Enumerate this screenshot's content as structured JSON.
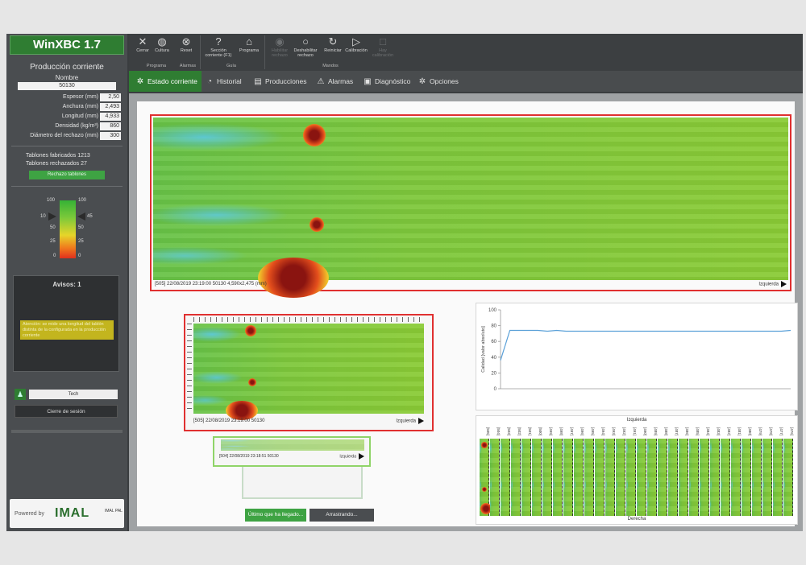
{
  "app": {
    "title": "WinXBC 1.7"
  },
  "sidebar": {
    "production_title": "Producción corriente",
    "name_label": "Nombre",
    "name_value": "50130",
    "params": [
      {
        "label": "Espesor (mm)",
        "value": "2,50"
      },
      {
        "label": "Anchura (mm)",
        "value": "2,493"
      },
      {
        "label": "Longitud (mm)",
        "value": "4,933"
      },
      {
        "label": "Densidad (kg/m³)",
        "value": "860"
      },
      {
        "label": "Diámetro del rechazo (mm)",
        "value": "300"
      }
    ],
    "boards_made_label": "Tablones fabricados",
    "boards_made_value": "1213",
    "boards_rejected_label": "Tablones rechazados",
    "boards_rejected_value": "27",
    "reject_button": "Rechazo tablones",
    "scale": {
      "left_top": "100",
      "left_threshold": "10",
      "left_50": "50",
      "left_25": "25",
      "left_0": "0",
      "right_top": "100",
      "right_threshold": "45",
      "right_50": "50",
      "right_25": "25",
      "right_0": "0"
    },
    "alerts_title": "Avisos: 1",
    "alert_message": "Atención: se mide una longitud del tablón distinta de la configurada en la producción corriente",
    "user_name": "Tech",
    "logout_button": "Cierre de sesión",
    "powered_by": "Powered by",
    "logo_text": "IMAL",
    "logo_sub": "IMAL PAL"
  },
  "ribbon": {
    "buttons": [
      {
        "icon": "✕",
        "label": "Cerrar"
      },
      {
        "icon": "◍",
        "label": "Cultura"
      },
      {
        "icon": "⊗",
        "label": "Reset"
      },
      {
        "icon": "?",
        "label": "Sección corriente (F1)"
      },
      {
        "icon": "⌂",
        "label": "Programa"
      },
      {
        "icon": "◉",
        "label": "Habilitar rechazo"
      },
      {
        "icon": "○",
        "label": "Deshabilitar rechazo"
      },
      {
        "icon": "↻",
        "label": "Reiniciar"
      },
      {
        "icon": "▷",
        "label": "Calibración"
      },
      {
        "icon": "□",
        "label": "Hay calibración"
      }
    ],
    "groups": {
      "programa": "Programa",
      "alarmas": "Alarmas",
      "guia": "Guía",
      "mandos": "Mandos"
    }
  },
  "tabs": [
    {
      "icon": "✲",
      "label": "Estado corriente"
    },
    {
      "icon": "◔",
      "label": "Historial"
    },
    {
      "icon": "▤",
      "label": "Producciones"
    },
    {
      "icon": "⚠",
      "label": "Alarmas"
    },
    {
      "icon": "▣",
      "label": "Diagnóstico"
    },
    {
      "icon": "✲",
      "label": "Opciones"
    }
  ],
  "main_heatmap": {
    "caption": "[505]   22/08/2019 23:19:00   50130   4,590x2,475 (mm)",
    "side": "Izquierda"
  },
  "small_heatmap": {
    "caption": "[505]   22/08/2019 23:19:00   50130",
    "side": "Izquierda"
  },
  "stack_heatmap": {
    "caption": "[504]   22/08/2019 23:18:51   50130",
    "side": "Izquierda"
  },
  "buttons": {
    "last_arrived": "Último que ha llegado...",
    "dragging": "Arrastrando..."
  },
  "chart_data": {
    "type": "line",
    "ylabel": "Calidad [valor absoluto]",
    "xlabel": "",
    "ylim": [
      0,
      100
    ],
    "yticks": [
      0,
      20,
      40,
      60,
      80,
      100
    ],
    "series": [
      {
        "values": [
          36,
          74,
          74,
          74,
          74,
          73,
          74,
          73,
          73,
          73,
          73,
          73,
          73,
          73,
          73,
          73,
          73,
          73,
          73,
          73,
          73,
          73,
          73,
          73,
          73,
          73,
          73,
          73,
          73,
          73,
          73,
          74
        ],
        "color": "#5aa0d8"
      }
    ]
  },
  "grid_view": {
    "top_label": "Izquierda",
    "bottom_label": "Derecha",
    "columns": [
      "[505]",
      "[504]",
      "[503]",
      "[502]",
      "[501]",
      "[500]",
      "[499]",
      "[498]",
      "[497]",
      "[496]",
      "[495]",
      "[494]",
      "[493]",
      "[492]",
      "[491]",
      "[490]",
      "[489]",
      "[488]",
      "[487]",
      "[486]",
      "[485]",
      "[484]",
      "[483]",
      "[482]",
      "[481]",
      "[480]",
      "[479]",
      "[478]",
      "[477]",
      "[476]"
    ]
  }
}
